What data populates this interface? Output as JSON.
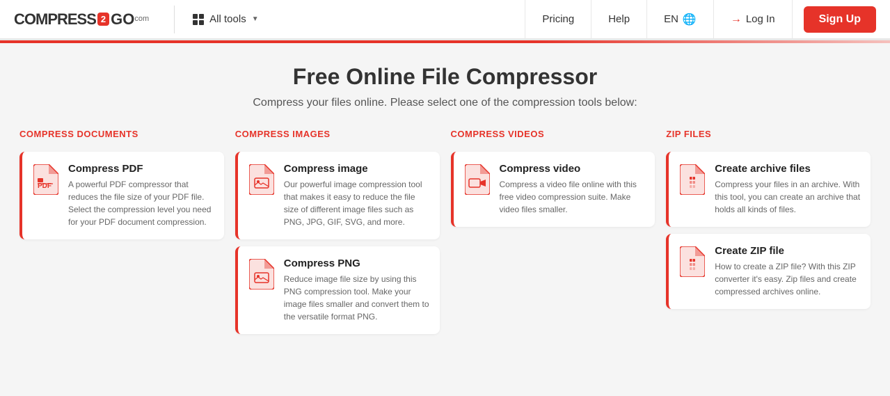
{
  "header": {
    "logo": {
      "compress": "COMPRESS",
      "badge": "2",
      "go": "GO",
      "com": "com"
    },
    "all_tools_label": "All tools",
    "nav": {
      "pricing": "Pricing",
      "help": "Help",
      "lang": "EN",
      "login": "Log In",
      "signup": "Sign Up"
    }
  },
  "hero": {
    "title": "Free Online File Compressor",
    "subtitle": "Compress your files online. Please select one of the compression tools below:"
  },
  "categories": [
    {
      "id": "compress-documents",
      "title": "COMPRESS DOCUMENTS",
      "tools": [
        {
          "name": "Compress PDF",
          "desc": "A powerful PDF compressor that reduces the file size of your PDF file. Select the compression level you need for your PDF document compression.",
          "icon_type": "pdf"
        }
      ]
    },
    {
      "id": "compress-images",
      "title": "COMPRESS IMAGES",
      "tools": [
        {
          "name": "Compress image",
          "desc": "Our powerful image compression tool that makes it easy to reduce the file size of different image files such as PNG, JPG, GIF, SVG, and more.",
          "icon_type": "img"
        },
        {
          "name": "Compress PNG",
          "desc": "Reduce image file size by using this PNG compression tool. Make your image files smaller and convert them to the versatile format PNG.",
          "icon_type": "img2"
        }
      ]
    },
    {
      "id": "compress-videos",
      "title": "COMPRESS VIDEOS",
      "tools": [
        {
          "name": "Compress video",
          "desc": "Compress a video file online with this free video compression suite. Make video files smaller.",
          "icon_type": "vid"
        }
      ]
    },
    {
      "id": "zip-files",
      "title": "ZIP FILES",
      "tools": [
        {
          "name": "Create archive files",
          "desc": "Compress your files in an archive. With this tool, you can create an archive that holds all kinds of files.",
          "icon_type": "zip"
        },
        {
          "name": "Create ZIP file",
          "desc": "How to create a ZIP file? With this ZIP converter it's easy. Zip files and create compressed archives online.",
          "icon_type": "zip"
        }
      ]
    }
  ]
}
